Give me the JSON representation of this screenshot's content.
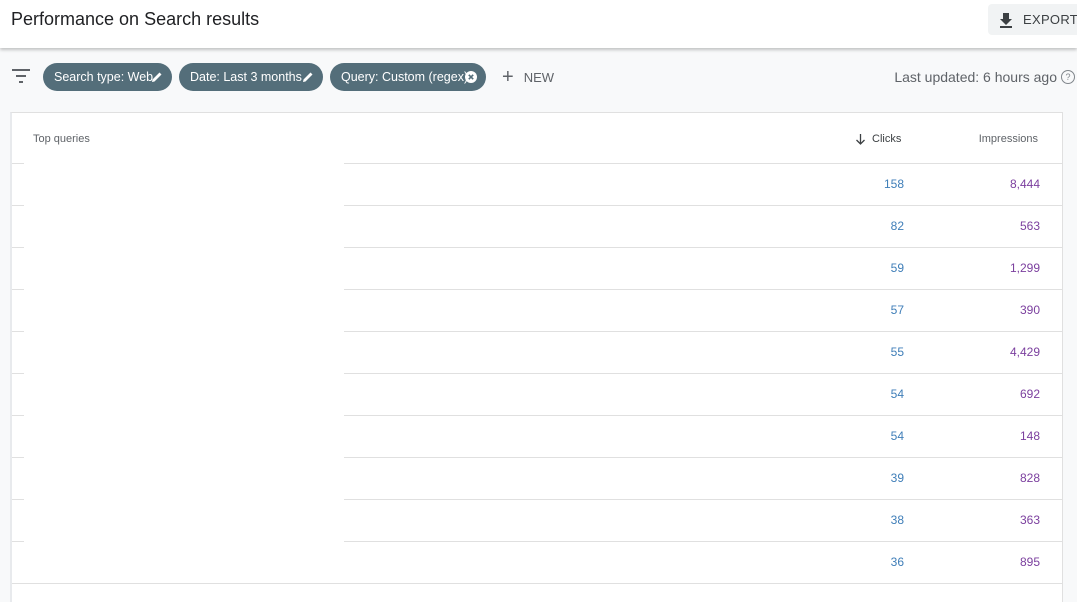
{
  "header": {
    "title": "Performance on Search results",
    "export_label": "EXPORT",
    "export_icon": "download-icon"
  },
  "filters": {
    "filter_icon": "filter-list-icon",
    "chips": [
      {
        "label": "Search type: Web",
        "icon": "edit-pencil-icon"
      },
      {
        "label": "Date: Last 3 months",
        "icon": "edit-pencil-icon"
      },
      {
        "label": "Query: Custom (regex)",
        "icon": "close-circle-icon"
      }
    ],
    "new_label": "NEW",
    "last_updated": "Last updated: 6 hours ago",
    "help_icon": "?"
  },
  "colors": {
    "chip_bg": "#546e7a",
    "clicks": "#3f7eb8",
    "impressions": "#7b3f9e"
  },
  "table": {
    "columns": {
      "queries": "Top queries",
      "clicks": "Clicks",
      "impressions": "Impressions",
      "sort": "descending"
    },
    "rows": [
      {
        "query": "",
        "clicks": "158",
        "impressions": "8,444"
      },
      {
        "query": "",
        "clicks": "82",
        "impressions": "563"
      },
      {
        "query": "",
        "clicks": "59",
        "impressions": "1,299"
      },
      {
        "query": "",
        "clicks": "57",
        "impressions": "390"
      },
      {
        "query": "",
        "clicks": "55",
        "impressions": "4,429"
      },
      {
        "query": "",
        "clicks": "54",
        "impressions": "692"
      },
      {
        "query": "",
        "clicks": "54",
        "impressions": "148"
      },
      {
        "query": "",
        "clicks": "39",
        "impressions": "828"
      },
      {
        "query": "",
        "clicks": "38",
        "impressions": "363"
      },
      {
        "query": "",
        "clicks": "36",
        "impressions": "895"
      }
    ]
  }
}
